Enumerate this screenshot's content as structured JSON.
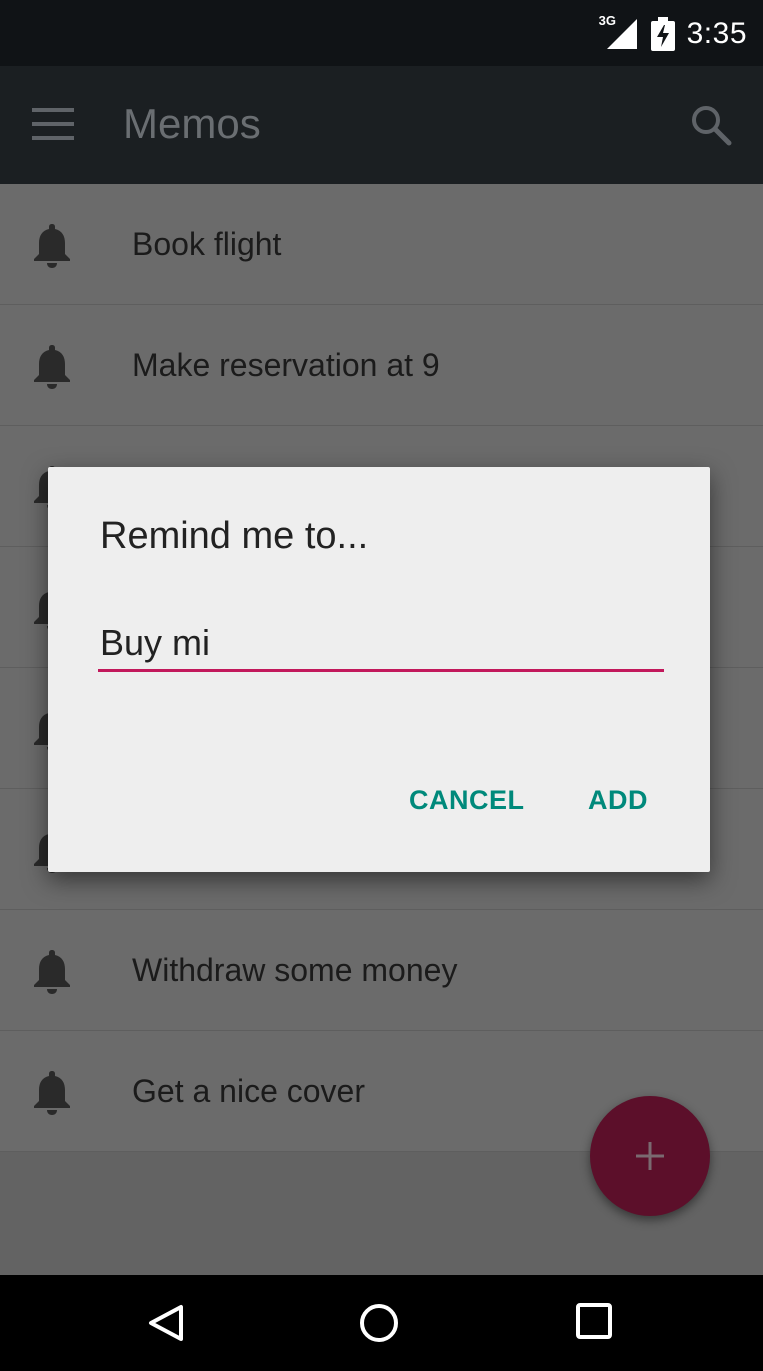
{
  "status_bar": {
    "network": "3G",
    "time": "3:35"
  },
  "app_bar": {
    "title": "Memos"
  },
  "memos": [
    {
      "text": "Book flight"
    },
    {
      "text": "Make reservation at 9"
    },
    {
      "text": ""
    },
    {
      "text": ""
    },
    {
      "text": ""
    },
    {
      "text": ""
    },
    {
      "text": "Withdraw some money"
    },
    {
      "text": "Get a nice cover"
    }
  ],
  "dialog": {
    "title": "Remind me to...",
    "input_value": "Buy mi",
    "cancel_label": "CANCEL",
    "add_label": "ADD"
  },
  "colors": {
    "accent": "#c2185b",
    "button_text": "#00897b",
    "fab": "#5c0f2a"
  },
  "icons": {
    "memo_item": "bell-icon",
    "fab": "plus-icon",
    "menu": "menu-icon",
    "search": "search-icon"
  }
}
